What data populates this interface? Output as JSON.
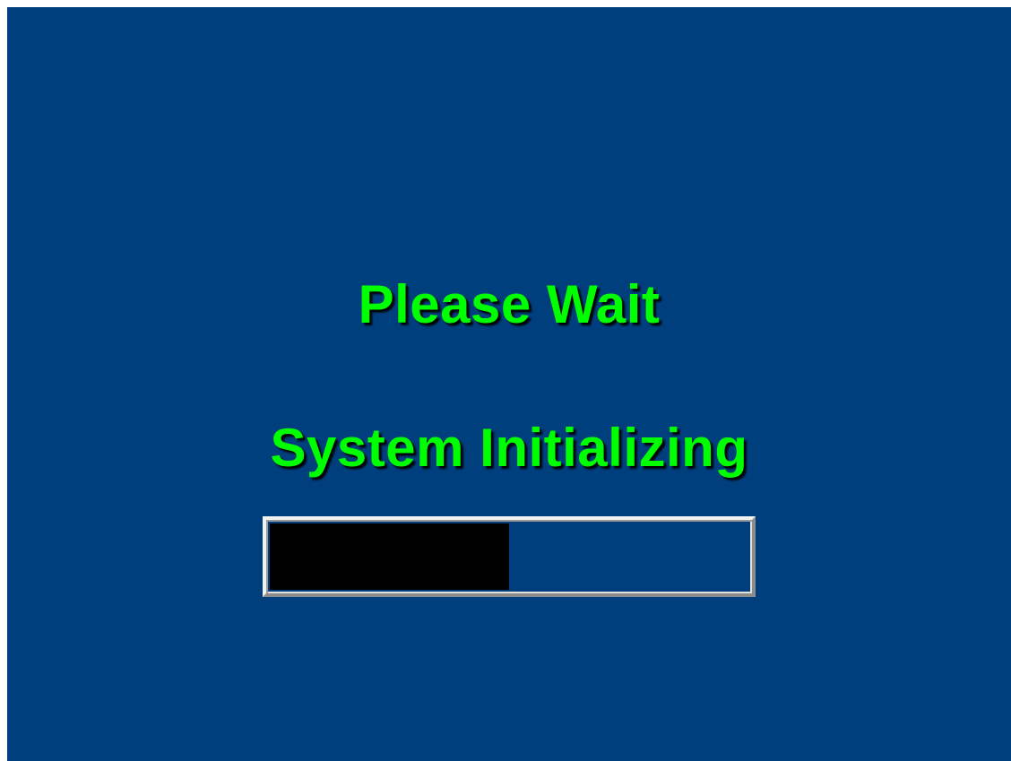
{
  "screen": {
    "background_color": "#003f7e",
    "text_color": "#00ff00",
    "title": "Please Wait",
    "status": "System Initializing"
  },
  "progress": {
    "fraction": 0.5,
    "fill_color": "#000000",
    "track_color": "#003f7e"
  }
}
